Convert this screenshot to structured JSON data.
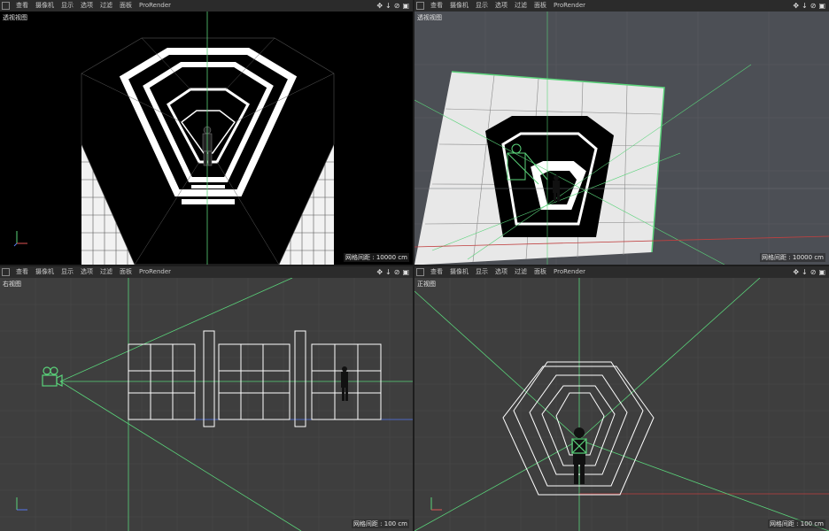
{
  "menu": [
    "查看",
    "摄像机",
    "显示",
    "选项",
    "过滤",
    "面板",
    "ProRender"
  ],
  "tools": [
    "✥",
    "↓",
    "⊘",
    "▣"
  ],
  "viewports": [
    {
      "title": "透视视图",
      "status": "网格间距 : 10000 cm"
    },
    {
      "title": "透视视图",
      "status": "网格间距 : 10000 cm"
    },
    {
      "title": "右视图",
      "status": "网格间距 : 100 cm"
    },
    {
      "title": "正视图",
      "status": "网格间距 : 100 cm"
    }
  ],
  "axes": {
    "y": "Y",
    "x": "X",
    "z": "Z"
  },
  "colors": {
    "menu_bg": "#2b2b2b",
    "viewport_bg": "#3a3a3a",
    "accent_green": "#5ad37a",
    "grid_line": "#454545"
  }
}
